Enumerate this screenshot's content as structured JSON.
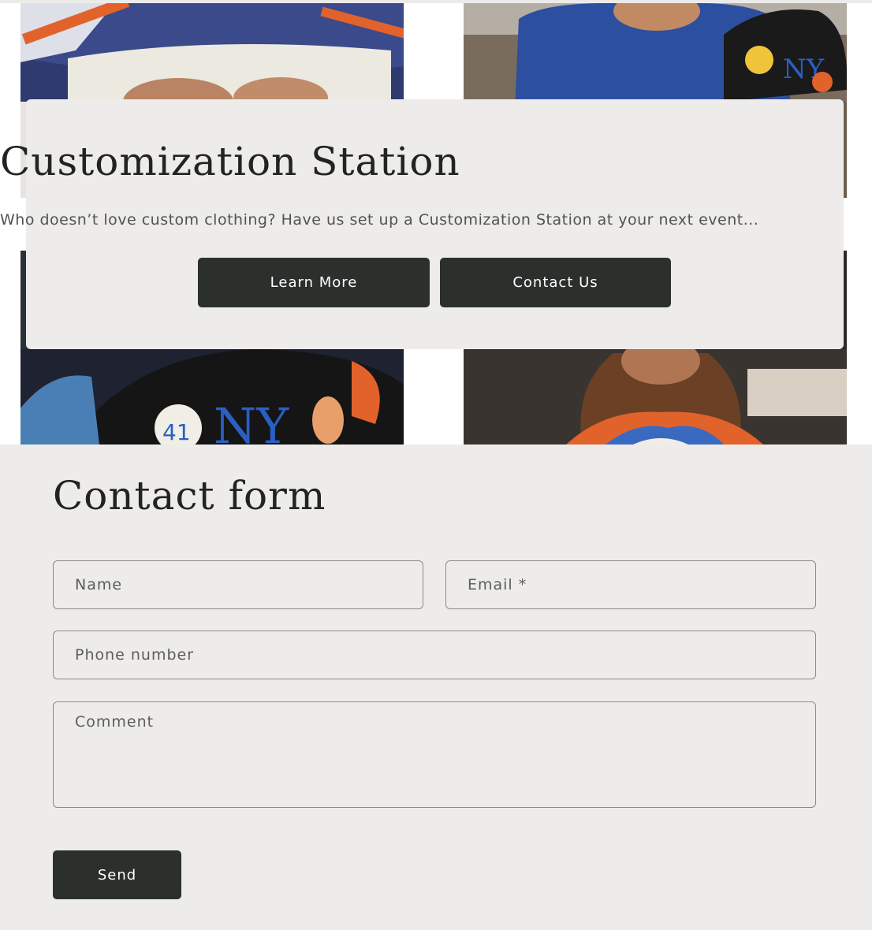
{
  "promo": {
    "title": "Customization Station",
    "text": "Who doesn’t love custom clothing? Have us set up a Customization Station at your next event...",
    "learn_more_label": "Learn More",
    "contact_us_label": "Contact Us"
  },
  "contact_form": {
    "title": "Contact form",
    "name_placeholder": "Name",
    "email_placeholder": "Email *",
    "phone_placeholder": "Phone number",
    "comment_placeholder": "Comment",
    "send_label": "Send"
  },
  "colors": {
    "button_dark": "#2b302d",
    "panel_bg": "#edecea",
    "orange_accent": "#e8622a",
    "mets_blue": "#2a5fc4"
  }
}
